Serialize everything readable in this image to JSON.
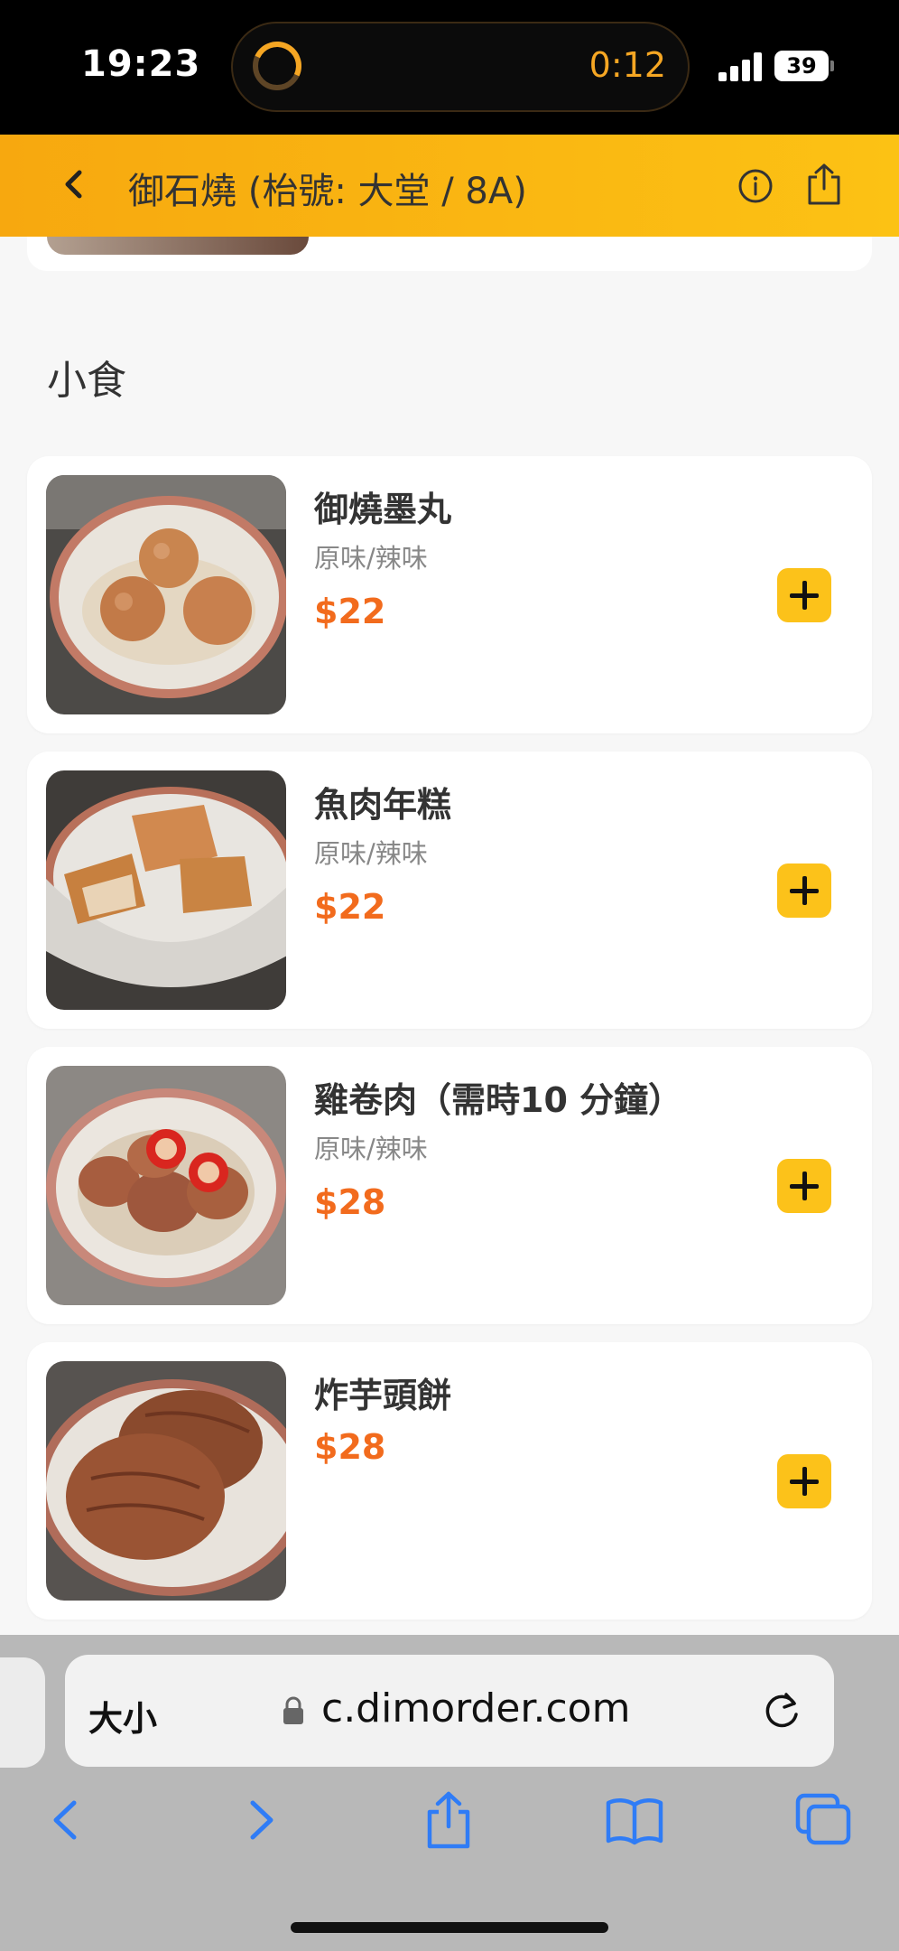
{
  "status": {
    "time": "19:23",
    "timer": "0:12",
    "battery": "39"
  },
  "header": {
    "title": "御石燒 (枱號: 大堂 / 8A)"
  },
  "section": {
    "title": "小食"
  },
  "items": [
    {
      "name": "御燒墨丸",
      "options": "原味/辣味",
      "price": "$22",
      "image": "fish-balls"
    },
    {
      "name": "魚肉年糕",
      "options": "原味/辣味",
      "price": "$22",
      "image": "fish-cakes"
    },
    {
      "name": "雞卷肉（需時10 分鐘）",
      "options": "原味/辣味",
      "price": "$28",
      "image": "chicken-rolls"
    },
    {
      "name": "炸芋頭餅",
      "options": "",
      "price": "$28",
      "image": "taro-cakes"
    }
  ],
  "browser": {
    "text_size_label": "大小",
    "url": "c.dimorder.com"
  },
  "colors": {
    "accent": "#fcc21a",
    "header_start": "#f7a80f",
    "header_end": "#fcc214",
    "price": "#f26b1d",
    "safari_blue": "#2f7cf6"
  }
}
